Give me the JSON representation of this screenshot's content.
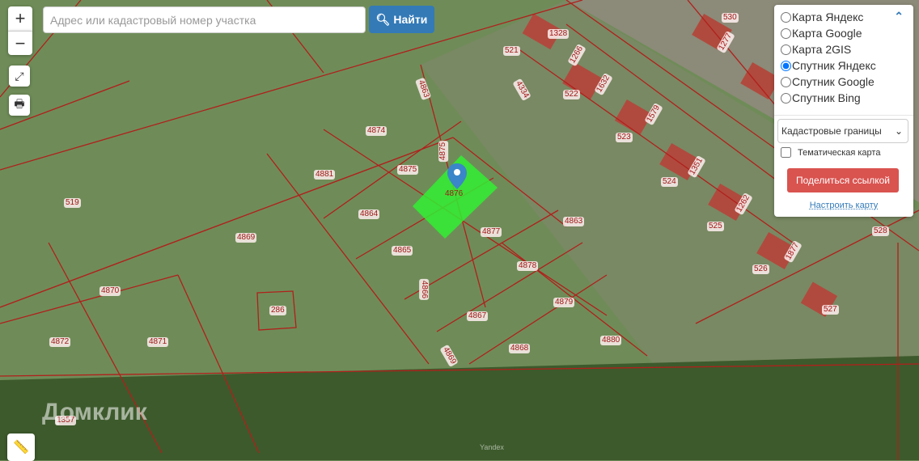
{
  "search": {
    "placeholder": "Адрес или кадастровый номер участка",
    "button": "Найти"
  },
  "controls": {
    "zoom_in": "+",
    "zoom_out": "−"
  },
  "layers": {
    "options": [
      "Карта Яндекс",
      "Карта Google",
      "Карта 2GIS",
      "Спутник Яндекс",
      "Спутник Google",
      "Спутник Bing"
    ],
    "selected": "Спутник Яндекс",
    "overlay_select": "Кадастровые границы",
    "thematic_label": "Тематическая карта",
    "thematic_checked": false,
    "share": "Поделиться ссылкой",
    "configure": "Настроить карту"
  },
  "parcels": [
    "1328",
    "530",
    "1277",
    "521",
    "1266",
    "4334",
    "522",
    "1632",
    "4863",
    "4874",
    "1579",
    "523",
    "4875",
    "4881",
    "4875",
    "1351",
    "524",
    "4876",
    "519",
    "4864",
    "4877",
    "4863",
    "1262",
    "525",
    "528",
    "4869",
    "4865",
    "4878",
    "526",
    "1877",
    "4870",
    "4866",
    "286",
    "4879",
    "527",
    "4867",
    "4872",
    "4871",
    "4880",
    "4868",
    "4869",
    "1357"
  ],
  "selected_parcel": "4876",
  "watermarks": {
    "brand": "Домклик",
    "provider": "Yandex"
  },
  "colors": {
    "selected_parcel": "#33ee33",
    "boundary": "#b0201c",
    "primary": "#337ab7",
    "danger": "#d9534f"
  }
}
